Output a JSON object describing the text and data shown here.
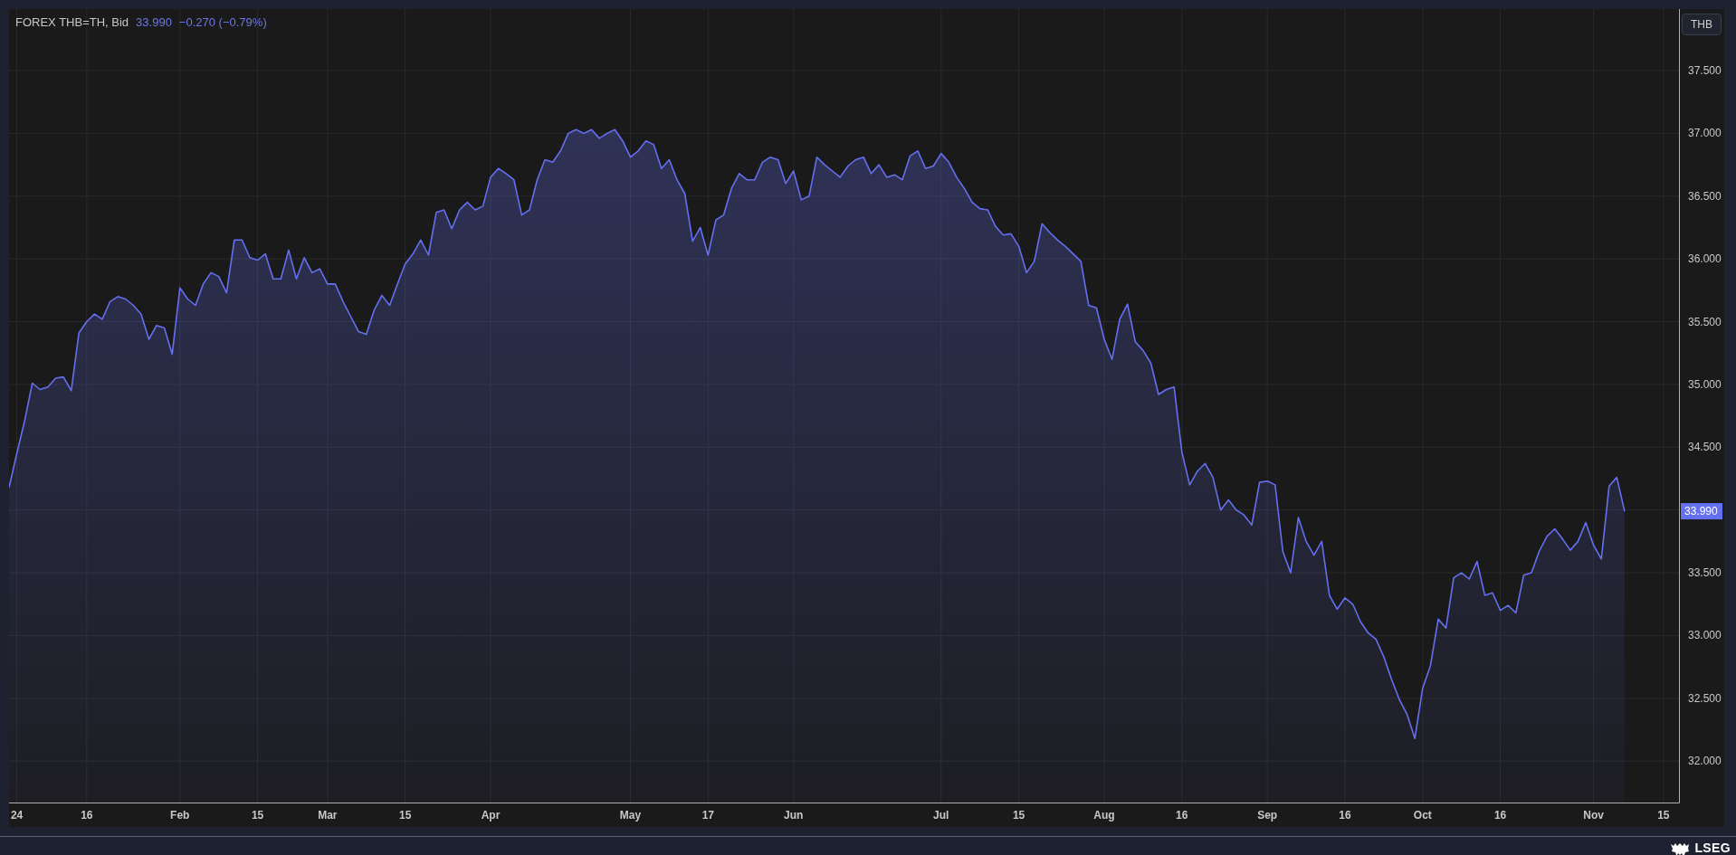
{
  "header": {
    "price": "33.990",
    "change": "−0.270 (−0.79%)"
  },
  "currency_button": "THB",
  "chart_data": {
    "type": "area",
    "grid": true,
    "ylim": [
      31.67,
      37.99
    ],
    "categories": [
      null,
      "24",
      null,
      null,
      null,
      null,
      null,
      null,
      null,
      null,
      "16",
      null,
      null,
      null,
      null,
      null,
      null,
      null,
      null,
      null,
      null,
      null,
      "Feb",
      null,
      null,
      null,
      null,
      null,
      null,
      null,
      null,
      null,
      "15",
      null,
      null,
      null,
      null,
      null,
      null,
      null,
      null,
      "Mar",
      null,
      null,
      null,
      null,
      null,
      null,
      null,
      null,
      null,
      "15",
      null,
      null,
      null,
      null,
      null,
      null,
      null,
      null,
      null,
      null,
      "Apr",
      null,
      null,
      null,
      null,
      null,
      null,
      null,
      null,
      null,
      null,
      null,
      null,
      null,
      null,
      null,
      null,
      null,
      "May",
      null,
      null,
      null,
      null,
      null,
      null,
      null,
      null,
      null,
      "17",
      null,
      null,
      null,
      null,
      null,
      null,
      null,
      null,
      null,
      null,
      "Jun",
      null,
      null,
      null,
      null,
      null,
      null,
      null,
      null,
      null,
      null,
      null,
      null,
      null,
      null,
      null,
      null,
      null,
      null,
      "Jul",
      null,
      null,
      null,
      null,
      null,
      null,
      null,
      null,
      null,
      "15",
      null,
      null,
      null,
      null,
      null,
      null,
      null,
      null,
      null,
      null,
      "Aug",
      null,
      null,
      null,
      null,
      null,
      null,
      null,
      null,
      null,
      "16",
      null,
      null,
      null,
      null,
      null,
      null,
      null,
      null,
      null,
      null,
      "Sep",
      null,
      null,
      null,
      null,
      null,
      null,
      null,
      null,
      null,
      "16",
      null,
      null,
      null,
      null,
      null,
      null,
      null,
      null,
      null,
      "Oct",
      null,
      null,
      null,
      null,
      null,
      null,
      null,
      null,
      null,
      "16",
      null,
      null,
      null,
      null,
      null,
      null,
      null,
      null,
      null,
      null,
      null,
      "Nov",
      null,
      null,
      null,
      null,
      null,
      null,
      null,
      null,
      "15",
      null
    ],
    "yticks": [
      {
        "value": 32,
        "label": "32.000"
      },
      {
        "value": 32.5,
        "label": "32.500"
      },
      {
        "value": 33,
        "label": "33.000"
      },
      {
        "value": 33.5,
        "label": "33.500"
      },
      {
        "value": 34.5,
        "label": "34.500"
      },
      {
        "value": 35,
        "label": "35.000"
      },
      {
        "value": 35.5,
        "label": "35.500"
      },
      {
        "value": 36,
        "label": "36.000"
      },
      {
        "value": 36.5,
        "label": "36.500"
      },
      {
        "value": 37,
        "label": "37.000"
      },
      {
        "value": 37.5,
        "label": "37.500"
      }
    ],
    "series": [
      {
        "name": "FOREX THB=TH, Bid",
        "color": "#6470f0",
        "values": [
          34.18,
          34.45,
          34.71,
          35.01,
          34.96,
          34.98,
          35.05,
          35.06,
          34.95,
          35.41,
          35.5,
          35.56,
          35.52,
          35.66,
          35.7,
          35.68,
          35.63,
          35.56,
          35.36,
          35.47,
          35.45,
          35.24,
          35.77,
          35.68,
          35.63,
          35.8,
          35.89,
          35.86,
          35.73,
          36.15,
          36.15,
          36.01,
          35.99,
          36.04,
          35.84,
          35.84,
          36.07,
          35.84,
          36.01,
          35.89,
          35.92,
          35.8,
          35.8,
          35.66,
          35.54,
          35.42,
          35.4,
          35.59,
          35.71,
          35.63,
          35.8,
          35.96,
          36.04,
          36.15,
          36.03,
          36.37,
          36.39,
          36.24,
          36.39,
          36.45,
          36.39,
          36.42,
          36.65,
          36.72,
          36.68,
          36.63,
          36.35,
          36.39,
          36.63,
          36.79,
          36.77,
          36.86,
          37.0,
          37.03,
          37.0,
          37.03,
          36.96,
          37.0,
          37.03,
          36.94,
          36.81,
          36.86,
          36.94,
          36.91,
          36.72,
          36.79,
          36.63,
          36.52,
          36.14,
          36.25,
          36.03,
          36.31,
          36.35,
          36.56,
          36.68,
          36.63,
          36.63,
          36.77,
          36.81,
          36.79,
          36.6,
          36.7,
          36.47,
          36.5,
          36.81,
          36.75,
          36.7,
          36.65,
          36.74,
          36.79,
          36.81,
          36.68,
          36.75,
          36.65,
          36.67,
          36.63,
          36.82,
          36.86,
          36.72,
          36.74,
          36.84,
          36.77,
          36.65,
          36.56,
          36.45,
          36.4,
          36.39,
          36.26,
          36.19,
          36.2,
          36.1,
          35.89,
          35.98,
          36.28,
          36.21,
          36.15,
          36.1,
          36.04,
          35.98,
          35.63,
          35.61,
          35.36,
          35.2,
          35.52,
          35.64,
          35.34,
          35.27,
          35.17,
          34.92,
          34.96,
          34.98,
          34.46,
          34.2,
          34.31,
          34.37,
          34.26,
          34.0,
          34.08,
          34.0,
          33.96,
          33.88,
          34.22,
          34.23,
          34.2,
          33.67,
          33.5,
          33.94,
          33.75,
          33.64,
          33.75,
          33.32,
          33.21,
          33.3,
          33.25,
          33.11,
          33.02,
          32.97,
          32.83,
          32.65,
          32.49,
          32.37,
          32.18,
          32.58,
          32.76,
          33.13,
          33.06,
          33.46,
          33.5,
          33.45,
          33.59,
          33.32,
          33.34,
          33.2,
          33.24,
          33.18,
          33.48,
          33.5,
          33.67,
          33.79,
          33.85,
          33.77,
          33.68,
          33.75,
          33.9,
          33.72,
          33.61,
          34.19,
          34.26,
          33.99,
          null,
          null,
          null,
          null,
          null,
          null
        ]
      }
    ]
  },
  "last_price_label": "33.990",
  "logo": "LSEG"
}
